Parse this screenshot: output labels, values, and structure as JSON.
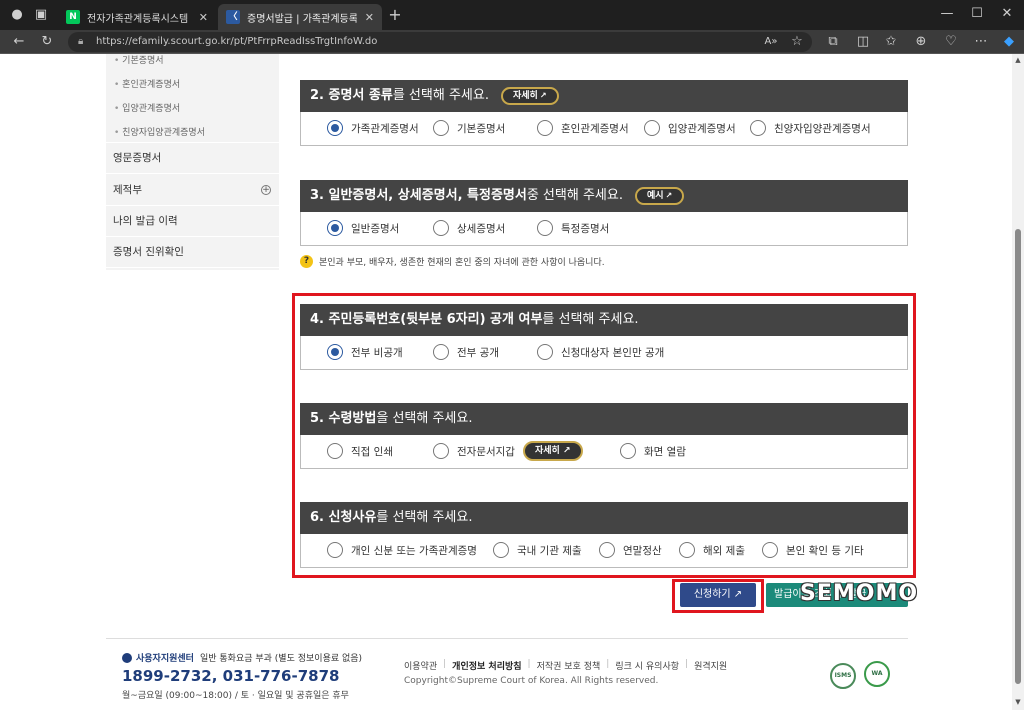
{
  "browser": {
    "tabs": [
      {
        "title": "전자가족관계등록시스템 : 네이버",
        "favicon": "N",
        "favicon_color": "#03c75a"
      },
      {
        "title": "증명서발급 | 가족관계등록부 | 가",
        "favicon": "〈",
        "favicon_color": "#2c5aa0"
      }
    ],
    "new_tab": "+",
    "url": "https://efamily.scourt.go.kr/pt/PtFrrpReadIssTrgtInfoW.do",
    "win_min": "—",
    "win_max": "☐",
    "win_close": "✕"
  },
  "sidebar": {
    "sub_items": [
      "기본증명서",
      "혼인관계증명서",
      "입양관계증명서",
      "친양자입양관계증명서"
    ],
    "items": [
      "영문증명서",
      "제적부",
      "나의 발급 이력",
      "증명서 진위확인"
    ]
  },
  "sections": {
    "s2": {
      "bold": "2. 증명서 종류",
      "normal": "를 선택해 주세요.",
      "pill": "자세히",
      "options": [
        "가족관계증명서",
        "기본증명서",
        "혼인관계증명서",
        "입양관계증명서",
        "친양자입양관계증명서"
      ],
      "selected": 0
    },
    "s3": {
      "bold": "3. 일반증명서, 상세증명서, 특정증명서",
      "normal": " 중 선택해 주세요.",
      "pill": "예시",
      "options": [
        "일반증명서",
        "상세증명서",
        "특정증명서"
      ],
      "selected": 0
    },
    "note": "본인과 부모, 배우자, 생존한 현재의 혼인 중의 자녀에 관한 사항이 나옵니다.",
    "s4": {
      "bold": "4. 주민등록번호(뒷부분 6자리) 공개 여부",
      "normal": "를 선택해 주세요.",
      "options": [
        "전부 비공개",
        "전부 공개",
        "신청대상자 본인만 공개"
      ],
      "selected": 0
    },
    "s5": {
      "bold": "5. 수령방법",
      "normal": "을 선택해 주세요.",
      "options": [
        "직접 인쇄",
        "전자문서지갑",
        "화면 열람"
      ],
      "inline_pill": "자세히",
      "selected": -1
    },
    "s6": {
      "bold": "6. 신청사유",
      "normal": "를 선택해 주세요.",
      "options": [
        "개인 신분 또는 가족관계증명",
        "국내 기관 제출",
        "연말정산",
        "해외 제출",
        "본인 확인 등 기타"
      ],
      "selected": -1
    }
  },
  "buttons": {
    "apply": "신청하기",
    "green": "발급이력 조회 후 발급"
  },
  "watermark": "SEMOMO",
  "footer": {
    "center_title": "사용자지원센터",
    "center_note": "일반 통화요금 부과 (별도 정보이용료 없음)",
    "phone": "1899-2732, 031-776-7878",
    "hours": "월~금요일 (09:00~18:00) / 토 · 일요일 및 공휴일은 휴무",
    "links": [
      "이용약관",
      "개인정보 처리방침",
      "저작권 보호 정책",
      "링크 시 유의사항",
      "원격지원"
    ],
    "copyright": "Copyright©Supreme Court of Korea. All Rights reserved.",
    "badge1": "ISMS",
    "badge2": "WA"
  },
  "colors": {
    "header_bg": "#444444",
    "radio_on": "#2c5aa0",
    "highlight": "#e0161e",
    "apply_btn": "#2f4a8a",
    "green_btn": "#1c8a7a"
  }
}
